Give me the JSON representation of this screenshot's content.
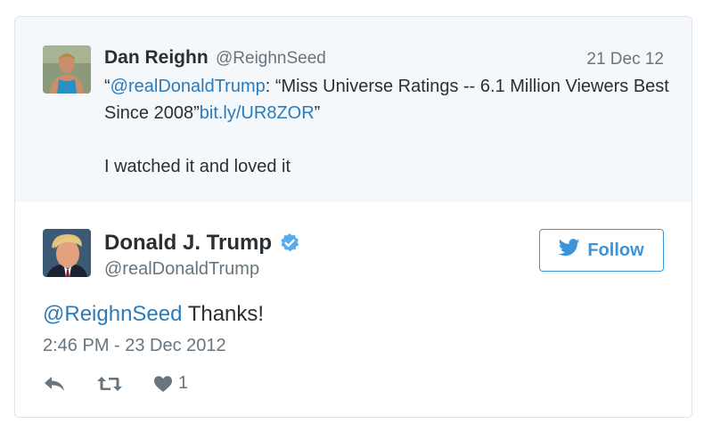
{
  "quoted": {
    "name": "Dan Reighn",
    "handle": "@ReighnSeed",
    "date": "21 Dec 12",
    "open_quote": "“",
    "mention": "@realDonaldTrump",
    "text_1": ": “Miss Universe Ratings -- 6.1 Million Viewers Best Since 2008”",
    "link": "bit.ly/UR8ZOR",
    "close_quote": "”",
    "text_2": "I watched it and loved it"
  },
  "tweet": {
    "name": "Donald J. Trump",
    "handle": "@realDonaldTrump",
    "verified_icon": "verified-badge-icon",
    "follow_label": "Follow",
    "reply_mention": "@ReighnSeed",
    "reply_text": " Thanks!",
    "timestamp": "2:46 PM - 23 Dec 2012",
    "like_count": "1"
  },
  "colors": {
    "link": "#2b7bb9",
    "quoted_bg": "#f5f8fa",
    "follow": "#3b94d9",
    "muted": "#66757f"
  }
}
